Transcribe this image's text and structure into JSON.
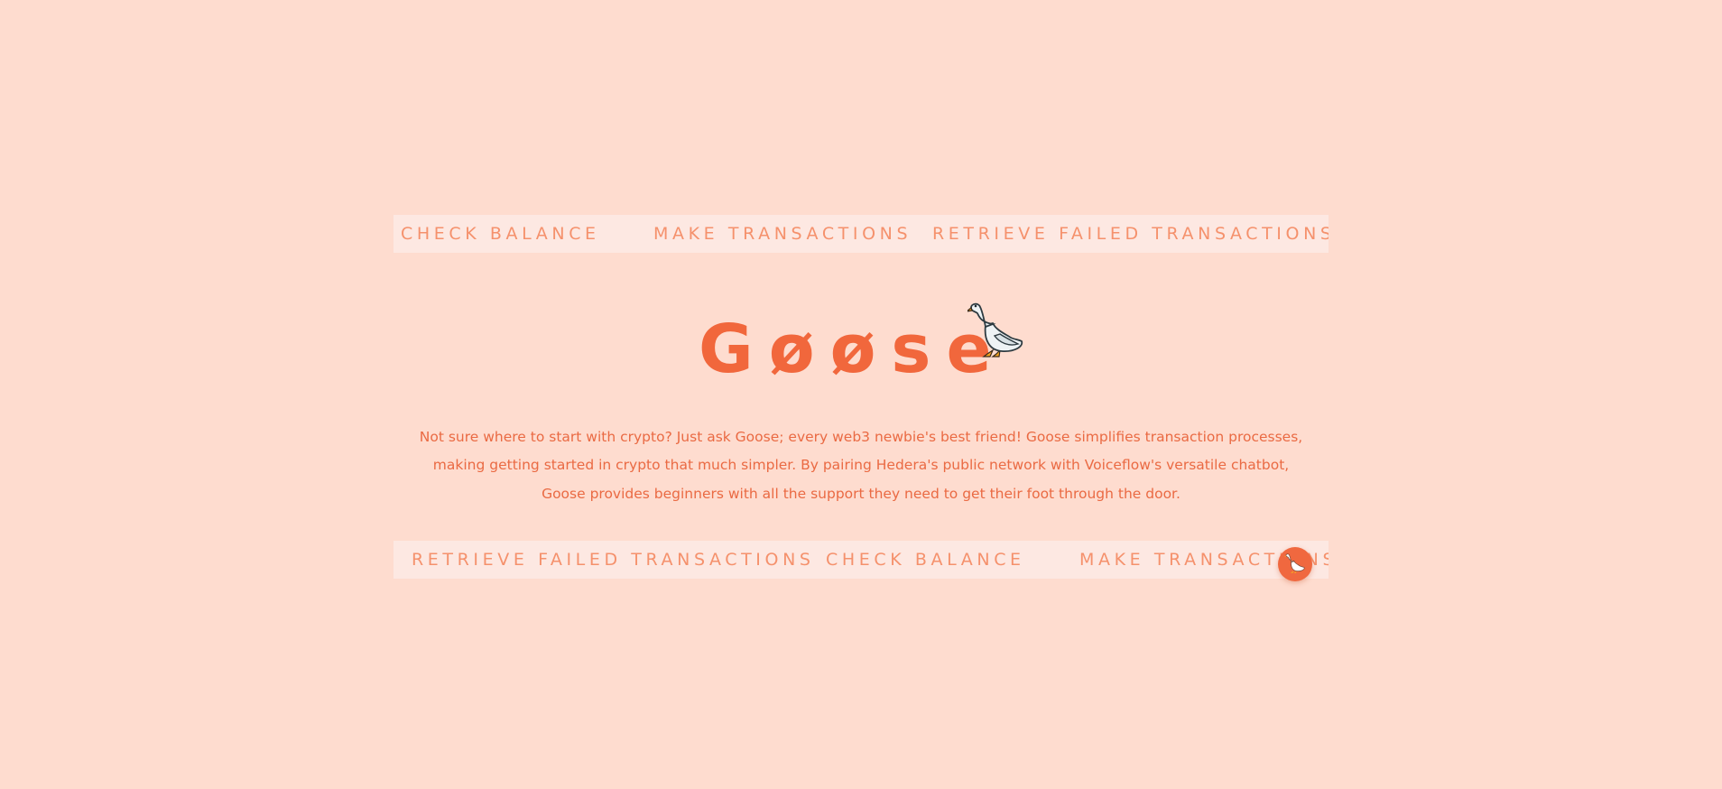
{
  "top_band": {
    "items": [
      "CHECK BALANCE",
      "MAKE TRANSACTIONS",
      "RETRIEVE FAILED TRANSACTIONS"
    ]
  },
  "hero": {
    "title": "Gøøse",
    "icon": "goose-icon"
  },
  "description": "Not sure where to start with crypto? Just ask Goose; every web3 newbie's best friend! Goose simplifies transaction processes, making getting started in crypto that much simpler. By pairing Hedera's public network with Voiceflow's versatile chatbot, Goose provides beginners with all the support they need to get their foot through the door.",
  "bottom_band": {
    "items": [
      "RETRIEVE FAILED TRANSACTIONS",
      "CHECK BALANCE",
      "MAKE TRANSACTIONS"
    ]
  },
  "chat_launcher": {
    "icon": "goose-icon"
  },
  "colors": {
    "background": "#fedccf",
    "band": "#fde8e2",
    "band_text": "#f5916c",
    "accent": "#f1673c"
  }
}
